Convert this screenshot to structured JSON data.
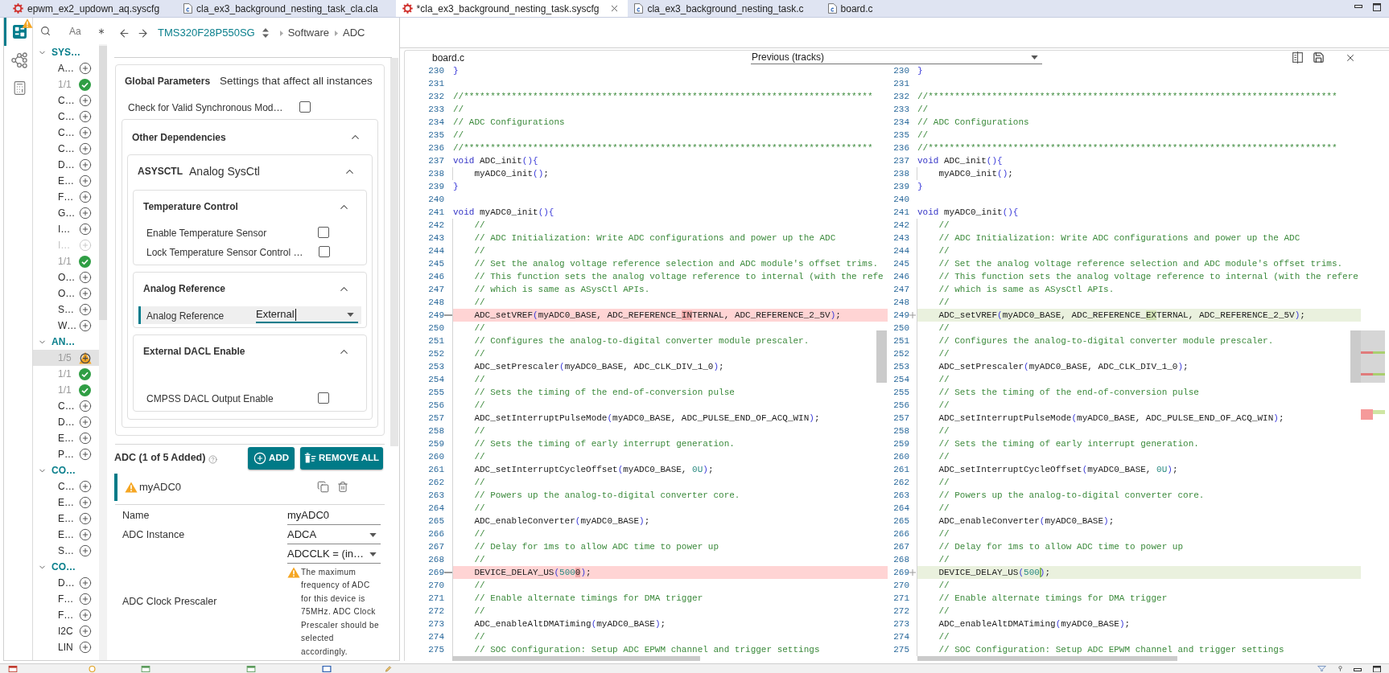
{
  "editor_tabs": [
    {
      "label": "epwm_ex2_updown_aq.syscfg",
      "kind": "syscfg",
      "selected": false
    },
    {
      "label": "cla_ex3_background_nesting_task_cla.cla",
      "kind": "source",
      "selected": false
    },
    {
      "label": "*cla_ex3_background_nesting_task.syscfg",
      "kind": "syscfg",
      "selected": true
    },
    {
      "label": "cla_ex3_background_nesting_task.c",
      "kind": "source",
      "selected": false
    },
    {
      "label": "board.c",
      "kind": "source",
      "selected": false
    }
  ],
  "sysconfig": {
    "sidebar": [
      {
        "kind": "dashboard",
        "selected": true,
        "warning": true
      },
      {
        "kind": "hierarchy",
        "selected": false,
        "warning": false
      },
      {
        "kind": "calculator",
        "selected": false,
        "warning": false
      }
    ],
    "module_tree": {
      "match_case": "Aa",
      "groups": [
        {
          "label": "SYS…",
          "expanded": true,
          "items": [
            {
              "label": "A…",
              "kind": "add",
              "selected": false
            },
            {
              "label": "1/1",
              "kind": "added",
              "selected": false
            },
            {
              "label": "C…",
              "kind": "add",
              "selected": false
            },
            {
              "label": "C…",
              "kind": "add",
              "selected": false
            },
            {
              "label": "C…",
              "kind": "add",
              "selected": false
            },
            {
              "label": "C…",
              "kind": "add",
              "selected": false
            },
            {
              "label": "D…",
              "kind": "add",
              "selected": false
            },
            {
              "label": "E…",
              "kind": "add",
              "selected": false
            },
            {
              "label": "F…",
              "kind": "add",
              "selected": false
            },
            {
              "label": "G…",
              "kind": "add",
              "selected": false
            },
            {
              "label": "I…",
              "kind": "add",
              "selected": false
            },
            {
              "label": "I…",
              "kind": "unavailable",
              "selected": false
            },
            {
              "label": "1/1",
              "kind": "added",
              "selected": false
            },
            {
              "label": "O…",
              "kind": "add",
              "selected": false
            },
            {
              "label": "O…",
              "kind": "add",
              "selected": false
            },
            {
              "label": "S…",
              "kind": "add",
              "selected": false
            },
            {
              "label": "W…",
              "kind": "add",
              "selected": false
            }
          ]
        },
        {
          "label": "AN…",
          "expanded": true,
          "items": [
            {
              "label": "1/5",
              "kind": "warning",
              "selected": true
            },
            {
              "label": "1/1",
              "kind": "added",
              "selected": false
            },
            {
              "label": "1/1",
              "kind": "added",
              "selected": false
            },
            {
              "label": "C…",
              "kind": "add",
              "selected": false
            },
            {
              "label": "D…",
              "kind": "add",
              "selected": false
            },
            {
              "label": "E…",
              "kind": "add",
              "selected": false
            },
            {
              "label": "P…",
              "kind": "add",
              "selected": false
            }
          ]
        },
        {
          "label": "CO…",
          "expanded": true,
          "items": [
            {
              "label": "C…",
              "kind": "add",
              "selected": false
            },
            {
              "label": "E…",
              "kind": "add",
              "selected": false
            },
            {
              "label": "E…",
              "kind": "add",
              "selected": false
            },
            {
              "label": "E…",
              "kind": "add",
              "selected": false
            },
            {
              "label": "S…",
              "kind": "add",
              "selected": false
            }
          ]
        },
        {
          "label": "CO…",
          "expanded": true,
          "items": [
            {
              "label": "D…",
              "kind": "add",
              "selected": false
            },
            {
              "label": "F…",
              "kind": "add",
              "selected": false
            },
            {
              "label": "F…",
              "kind": "add",
              "selected": false
            },
            {
              "label": "I2C",
              "kind": "add",
              "selected": false
            },
            {
              "label": "LIN",
              "kind": "add",
              "selected": false
            }
          ]
        }
      ]
    },
    "breadcrumb": {
      "device": "TMS320F28P550SG",
      "path": [
        "Software",
        "ADC"
      ]
    },
    "global_parameters": {
      "title": "Global Parameters",
      "subtitle": "Settings that affect all instances",
      "settings": [
        {
          "label": "Check for Valid Synchronous Mod…",
          "checked": false
        }
      ],
      "dependencies": {
        "title": "Other Dependencies",
        "expanded": true,
        "modules": [
          {
            "code": "ASYSCTL",
            "name": "Analog SysCtl",
            "expanded": true,
            "groups": [
              {
                "title": "Temperature Control",
                "expanded": true,
                "fields": [
                  {
                    "kind": "checkbox",
                    "label": "Enable Temperature Sensor",
                    "checked": false
                  },
                  {
                    "kind": "checkbox",
                    "label": "Lock Temperature Sensor Control …",
                    "checked": false
                  }
                ]
              },
              {
                "title": "Analog Reference",
                "expanded": true,
                "fields": [
                  {
                    "kind": "dropdown",
                    "label": "Analog Reference",
                    "value": "External",
                    "focused": true
                  }
                ]
              },
              {
                "title": "External DACL Enable",
                "expanded": true,
                "fields": [
                  {
                    "kind": "checkbox",
                    "label": "CMPSS DACL Output Enable",
                    "checked": false
                  }
                ]
              }
            ]
          }
        ]
      }
    },
    "module": {
      "title": "ADC (1 of 5 Added)",
      "buttons": [
        {
          "kind": "add",
          "label": "ADD"
        },
        {
          "kind": "remove_all",
          "label": "REMOVE ALL"
        }
      ],
      "instances": [
        {
          "name": "myADC0",
          "warning": true,
          "selected": true
        }
      ],
      "fields": [
        {
          "kind": "text",
          "label": "Name",
          "value": "myADC0"
        },
        {
          "kind": "dropdown",
          "label": "ADC Instance",
          "value": "ADCA"
        },
        {
          "kind": "dropdown",
          "label": "ADC Clock Prescaler",
          "value": "ADCCLK = (in…",
          "warning": "The maximum frequency of ADC for this device is 75MHz. ADC Clock Prescaler should be selected accordingly."
        }
      ]
    }
  },
  "compare": {
    "title": "board.c",
    "source": "Previous (tracks)",
    "panes": [
      {
        "kind": "local",
        "lines": [
          {
            "number": "230",
            "changed": false,
            "segments": [
              {
                "kind": "bracket",
                "text": "}"
              }
            ]
          },
          {
            "number": "231",
            "changed": false
          },
          {
            "number": "232",
            "changed": false,
            "segments": [
              {
                "kind": "comment",
                "text": "//*****************************************************************************"
              }
            ]
          },
          {
            "number": "233",
            "changed": false,
            "segments": [
              {
                "kind": "comment",
                "text": "//"
              }
            ]
          },
          {
            "number": "234",
            "changed": false,
            "segments": [
              {
                "kind": "comment",
                "text": "// ADC Configurations"
              }
            ]
          },
          {
            "number": "235",
            "changed": false,
            "segments": [
              {
                "kind": "comment",
                "text": "//"
              }
            ]
          },
          {
            "number": "236",
            "changed": false,
            "segments": [
              {
                "kind": "comment",
                "text": "//*****************************************************************************"
              }
            ]
          },
          {
            "number": "237",
            "changed": false,
            "segments": [
              {
                "kind": "keyword",
                "text": "void"
              },
              {
                "kind": "plain",
                "text": " ADC_init"
              },
              {
                "kind": "bracket",
                "text": "(){"
              }
            ]
          },
          {
            "number": "238",
            "changed": false,
            "segments": [
              {
                "kind": "plain",
                "text": "    myADC0_init"
              },
              {
                "kind": "bracket",
                "text": "()"
              },
              {
                "kind": "plain",
                "text": ";"
              }
            ]
          },
          {
            "number": "239",
            "changed": false,
            "segments": [
              {
                "kind": "bracket",
                "text": "}"
              }
            ]
          },
          {
            "number": "240",
            "changed": false
          },
          {
            "number": "241",
            "changed": false,
            "segments": [
              {
                "kind": "keyword",
                "text": "void"
              },
              {
                "kind": "plain",
                "text": " myADC0_init"
              },
              {
                "kind": "bracket",
                "text": "(){"
              }
            ]
          },
          {
            "number": "242",
            "changed": false,
            "segments": [
              {
                "kind": "comment",
                "text": "    //"
              }
            ]
          },
          {
            "number": "243",
            "changed": false,
            "segments": [
              {
                "kind": "comment",
                "text": "    // ADC Initialization: Write ADC configurations and power up the ADC"
              }
            ]
          },
          {
            "number": "244",
            "changed": false,
            "segments": [
              {
                "kind": "comment",
                "text": "    //"
              }
            ]
          },
          {
            "number": "245",
            "changed": false,
            "segments": [
              {
                "kind": "comment",
                "text": "    // Set the analog voltage reference selection and ADC module's offset trims."
              }
            ]
          },
          {
            "number": "246",
            "changed": false,
            "segments": [
              {
                "kind": "comment",
                "text": "    // This function sets the analog voltage reference to internal (with the refe"
              }
            ]
          },
          {
            "number": "247",
            "changed": false,
            "segments": [
              {
                "kind": "comment",
                "text": "    // which is same as ASysCtl APIs."
              }
            ]
          },
          {
            "number": "248",
            "changed": false,
            "segments": [
              {
                "kind": "comment",
                "text": "    //"
              }
            ]
          },
          {
            "number": "249",
            "changed": true,
            "segments": [
              {
                "kind": "plain",
                "text": "    ADC_setVREF"
              },
              {
                "kind": "bracket",
                "text": "("
              },
              {
                "kind": "plain",
                "text": "myADC0_BASE, ADC_REFERENCE_"
              },
              {
                "kind": "diff",
                "text": "IN"
              },
              {
                "kind": "plain",
                "text": "TERNAL, ADC_REFERENCE_2_5V"
              },
              {
                "kind": "bracket",
                "text": ")"
              },
              {
                "kind": "plain",
                "text": ";"
              }
            ]
          },
          {
            "number": "250",
            "changed": false,
            "segments": [
              {
                "kind": "comment",
                "text": "    //"
              }
            ]
          },
          {
            "number": "251",
            "changed": false,
            "segments": [
              {
                "kind": "comment",
                "text": "    // Configures the analog-to-digital converter module prescaler."
              }
            ]
          },
          {
            "number": "252",
            "changed": false,
            "segments": [
              {
                "kind": "comment",
                "text": "    //"
              }
            ]
          },
          {
            "number": "253",
            "changed": false,
            "segments": [
              {
                "kind": "plain",
                "text": "    ADC_setPrescaler"
              },
              {
                "kind": "bracket",
                "text": "("
              },
              {
                "kind": "plain",
                "text": "myADC0_BASE, ADC_CLK_DIV_1_0"
              },
              {
                "kind": "bracket",
                "text": ")"
              },
              {
                "kind": "plain",
                "text": ";"
              }
            ]
          },
          {
            "number": "254",
            "changed": false,
            "segments": [
              {
                "kind": "comment",
                "text": "    //"
              }
            ]
          },
          {
            "number": "255",
            "changed": false,
            "segments": [
              {
                "kind": "comment",
                "text": "    // Sets the timing of the end-of-conversion pulse"
              }
            ]
          },
          {
            "number": "256",
            "changed": false,
            "segments": [
              {
                "kind": "comment",
                "text": "    //"
              }
            ]
          },
          {
            "number": "257",
            "changed": false,
            "segments": [
              {
                "kind": "plain",
                "text": "    ADC_setInterruptPulseMode"
              },
              {
                "kind": "bracket",
                "text": "("
              },
              {
                "kind": "plain",
                "text": "myADC0_BASE, ADC_PULSE_END_OF_ACQ_WIN"
              },
              {
                "kind": "bracket",
                "text": ")"
              },
              {
                "kind": "plain",
                "text": ";"
              }
            ]
          },
          {
            "number": "258",
            "changed": false,
            "segments": [
              {
                "kind": "comment",
                "text": "    //"
              }
            ]
          },
          {
            "number": "259",
            "changed": false,
            "segments": [
              {
                "kind": "comment",
                "text": "    // Sets the timing of early interrupt generation."
              }
            ]
          },
          {
            "number": "260",
            "changed": false,
            "segments": [
              {
                "kind": "comment",
                "text": "    //"
              }
            ]
          },
          {
            "number": "261",
            "changed": false,
            "segments": [
              {
                "kind": "plain",
                "text": "    ADC_setInterruptCycleOffset"
              },
              {
                "kind": "bracket",
                "text": "("
              },
              {
                "kind": "plain",
                "text": "myADC0_BASE, "
              },
              {
                "kind": "number",
                "text": "0U"
              },
              {
                "kind": "bracket",
                "text": ")"
              },
              {
                "kind": "plain",
                "text": ";"
              }
            ]
          },
          {
            "number": "262",
            "changed": false,
            "segments": [
              {
                "kind": "comment",
                "text": "    //"
              }
            ]
          },
          {
            "number": "263",
            "changed": false,
            "segments": [
              {
                "kind": "comment",
                "text": "    // Powers up the analog-to-digital converter core."
              }
            ]
          },
          {
            "number": "264",
            "changed": false,
            "segments": [
              {
                "kind": "comment",
                "text": "    //"
              }
            ]
          },
          {
            "number": "265",
            "changed": false,
            "segments": [
              {
                "kind": "plain",
                "text": "    ADC_enableConverter"
              },
              {
                "kind": "bracket",
                "text": "("
              },
              {
                "kind": "plain",
                "text": "myADC0_BASE"
              },
              {
                "kind": "bracket",
                "text": ")"
              },
              {
                "kind": "plain",
                "text": ";"
              }
            ]
          },
          {
            "number": "266",
            "changed": false,
            "segments": [
              {
                "kind": "comment",
                "text": "    //"
              }
            ]
          },
          {
            "number": "267",
            "changed": false,
            "segments": [
              {
                "kind": "comment",
                "text": "    // Delay for 1ms to allow ADC time to power up"
              }
            ]
          },
          {
            "number": "268",
            "changed": false,
            "segments": [
              {
                "kind": "comment",
                "text": "    //"
              }
            ]
          },
          {
            "number": "269",
            "changed": true,
            "segments": [
              {
                "kind": "plain",
                "text": "    DEVICE_DELAY_US"
              },
              {
                "kind": "bracket",
                "text": "("
              },
              {
                "kind": "number",
                "text": "500"
              },
              {
                "kind": "diff",
                "text": "0"
              },
              {
                "kind": "bracket",
                "text": ")"
              },
              {
                "kind": "plain",
                "text": ";"
              }
            ]
          },
          {
            "number": "270",
            "changed": false,
            "segments": [
              {
                "kind": "comment",
                "text": "    //"
              }
            ]
          },
          {
            "number": "271",
            "changed": false,
            "segments": [
              {
                "kind": "comment",
                "text": "    // Enable alternate timings for DMA trigger"
              }
            ]
          },
          {
            "number": "272",
            "changed": false,
            "segments": [
              {
                "kind": "comment",
                "text": "    //"
              }
            ]
          },
          {
            "number": "273",
            "changed": false,
            "segments": [
              {
                "kind": "plain",
                "text": "    ADC_enableAltDMATiming"
              },
              {
                "kind": "bracket",
                "text": "("
              },
              {
                "kind": "plain",
                "text": "myADC0_BASE"
              },
              {
                "kind": "bracket",
                "text": ")"
              },
              {
                "kind": "plain",
                "text": ";"
              }
            ]
          },
          {
            "number": "274",
            "changed": false,
            "segments": [
              {
                "kind": "comment",
                "text": "    //"
              }
            ]
          },
          {
            "number": "275",
            "changed": false,
            "segments": [
              {
                "kind": "comment",
                "text": "    // SOC Configuration: Setup ADC EPWM channel and trigger settings"
              }
            ]
          }
        ]
      },
      {
        "kind": "previous",
        "lines": [
          {
            "number": "230",
            "changed": false,
            "segments": [
              {
                "kind": "bracket",
                "text": "}"
              }
            ]
          },
          {
            "number": "231",
            "changed": false
          },
          {
            "number": "232",
            "changed": false,
            "segments": [
              {
                "kind": "comment",
                "text": "//*****************************************************************************"
              }
            ]
          },
          {
            "number": "233",
            "changed": false,
            "segments": [
              {
                "kind": "comment",
                "text": "//"
              }
            ]
          },
          {
            "number": "234",
            "changed": false,
            "segments": [
              {
                "kind": "comment",
                "text": "// ADC Configurations"
              }
            ]
          },
          {
            "number": "235",
            "changed": false,
            "segments": [
              {
                "kind": "comment",
                "text": "//"
              }
            ]
          },
          {
            "number": "236",
            "changed": false,
            "segments": [
              {
                "kind": "comment",
                "text": "//*****************************************************************************"
              }
            ]
          },
          {
            "number": "237",
            "changed": false,
            "segments": [
              {
                "kind": "keyword",
                "text": "void"
              },
              {
                "kind": "plain",
                "text": " ADC_init"
              },
              {
                "kind": "bracket",
                "text": "(){"
              }
            ]
          },
          {
            "number": "238",
            "changed": false,
            "segments": [
              {
                "kind": "plain",
                "text": "    myADC0_init"
              },
              {
                "kind": "bracket",
                "text": "()"
              },
              {
                "kind": "plain",
                "text": ";"
              }
            ]
          },
          {
            "number": "239",
            "changed": false,
            "segments": [
              {
                "kind": "bracket",
                "text": "}"
              }
            ]
          },
          {
            "number": "240",
            "changed": false
          },
          {
            "number": "241",
            "changed": false,
            "segments": [
              {
                "kind": "keyword",
                "text": "void"
              },
              {
                "kind": "plain",
                "text": " myADC0_init"
              },
              {
                "kind": "bracket",
                "text": "(){"
              }
            ]
          },
          {
            "number": "242",
            "changed": false,
            "segments": [
              {
                "kind": "comment",
                "text": "    //"
              }
            ]
          },
          {
            "number": "243",
            "changed": false,
            "segments": [
              {
                "kind": "comment",
                "text": "    // ADC Initialization: Write ADC configurations and power up the ADC"
              }
            ]
          },
          {
            "number": "244",
            "changed": false,
            "segments": [
              {
                "kind": "comment",
                "text": "    //"
              }
            ]
          },
          {
            "number": "245",
            "changed": false,
            "segments": [
              {
                "kind": "comment",
                "text": "    // Set the analog voltage reference selection and ADC module's offset trims."
              }
            ]
          },
          {
            "number": "246",
            "changed": false,
            "segments": [
              {
                "kind": "comment",
                "text": "    // This function sets the analog voltage reference to internal (with the refere"
              }
            ]
          },
          {
            "number": "247",
            "changed": false,
            "segments": [
              {
                "kind": "comment",
                "text": "    // which is same as ASysCtl APIs."
              }
            ]
          },
          {
            "number": "248",
            "changed": false,
            "segments": [
              {
                "kind": "comment",
                "text": "    //"
              }
            ]
          },
          {
            "number": "249",
            "changed": true,
            "segments": [
              {
                "kind": "plain",
                "text": "    ADC_setVREF"
              },
              {
                "kind": "bracket",
                "text": "("
              },
              {
                "kind": "plain",
                "text": "myADC0_BASE, ADC_REFERENCE_"
              },
              {
                "kind": "diff",
                "text": "EX"
              },
              {
                "kind": "plain",
                "text": "TERNAL, ADC_REFERENCE_2_5V"
              },
              {
                "kind": "bracket",
                "text": ")"
              },
              {
                "kind": "plain",
                "text": ";"
              }
            ]
          },
          {
            "number": "250",
            "changed": false,
            "segments": [
              {
                "kind": "comment",
                "text": "    //"
              }
            ]
          },
          {
            "number": "251",
            "changed": false,
            "segments": [
              {
                "kind": "comment",
                "text": "    // Configures the analog-to-digital converter module prescaler."
              }
            ]
          },
          {
            "number": "252",
            "changed": false,
            "segments": [
              {
                "kind": "comment",
                "text": "    //"
              }
            ]
          },
          {
            "number": "253",
            "changed": false,
            "segments": [
              {
                "kind": "plain",
                "text": "    ADC_setPrescaler"
              },
              {
                "kind": "bracket",
                "text": "("
              },
              {
                "kind": "plain",
                "text": "myADC0_BASE, ADC_CLK_DIV_1_0"
              },
              {
                "kind": "bracket",
                "text": ")"
              },
              {
                "kind": "plain",
                "text": ";"
              }
            ]
          },
          {
            "number": "254",
            "changed": false,
            "segments": [
              {
                "kind": "comment",
                "text": "    //"
              }
            ]
          },
          {
            "number": "255",
            "changed": false,
            "segments": [
              {
                "kind": "comment",
                "text": "    // Sets the timing of the end-of-conversion pulse"
              }
            ]
          },
          {
            "number": "256",
            "changed": false,
            "segments": [
              {
                "kind": "comment",
                "text": "    //"
              }
            ]
          },
          {
            "number": "257",
            "changed": false,
            "segments": [
              {
                "kind": "plain",
                "text": "    ADC_setInterruptPulseMode"
              },
              {
                "kind": "bracket",
                "text": "("
              },
              {
                "kind": "plain",
                "text": "myADC0_BASE, ADC_PULSE_END_OF_ACQ_WIN"
              },
              {
                "kind": "bracket",
                "text": ")"
              },
              {
                "kind": "plain",
                "text": ";"
              }
            ]
          },
          {
            "number": "258",
            "changed": false,
            "segments": [
              {
                "kind": "comment",
                "text": "    //"
              }
            ]
          },
          {
            "number": "259",
            "changed": false,
            "segments": [
              {
                "kind": "comment",
                "text": "    // Sets the timing of early interrupt generation."
              }
            ]
          },
          {
            "number": "260",
            "changed": false,
            "segments": [
              {
                "kind": "comment",
                "text": "    //"
              }
            ]
          },
          {
            "number": "261",
            "changed": false,
            "segments": [
              {
                "kind": "plain",
                "text": "    ADC_setInterruptCycleOffset"
              },
              {
                "kind": "bracket",
                "text": "("
              },
              {
                "kind": "plain",
                "text": "myADC0_BASE, "
              },
              {
                "kind": "number",
                "text": "0U"
              },
              {
                "kind": "bracket",
                "text": ")"
              },
              {
                "kind": "plain",
                "text": ";"
              }
            ]
          },
          {
            "number": "262",
            "changed": false,
            "segments": [
              {
                "kind": "comment",
                "text": "    //"
              }
            ]
          },
          {
            "number": "263",
            "changed": false,
            "segments": [
              {
                "kind": "comment",
                "text": "    // Powers up the analog-to-digital converter core."
              }
            ]
          },
          {
            "number": "264",
            "changed": false,
            "segments": [
              {
                "kind": "comment",
                "text": "    //"
              }
            ]
          },
          {
            "number": "265",
            "changed": false,
            "segments": [
              {
                "kind": "plain",
                "text": "    ADC_enableConverter"
              },
              {
                "kind": "bracket",
                "text": "("
              },
              {
                "kind": "plain",
                "text": "myADC0_BASE"
              },
              {
                "kind": "bracket",
                "text": ")"
              },
              {
                "kind": "plain",
                "text": ";"
              }
            ]
          },
          {
            "number": "266",
            "changed": false,
            "segments": [
              {
                "kind": "comment",
                "text": "    //"
              }
            ]
          },
          {
            "number": "267",
            "changed": false,
            "segments": [
              {
                "kind": "comment",
                "text": "    // Delay for 1ms to allow ADC time to power up"
              }
            ]
          },
          {
            "number": "268",
            "changed": false,
            "segments": [
              {
                "kind": "comment",
                "text": "    //"
              }
            ]
          },
          {
            "number": "269",
            "changed": true,
            "segments": [
              {
                "kind": "plain",
                "text": "    DEVICE_DELAY_US"
              },
              {
                "kind": "bracket",
                "text": "("
              },
              {
                "kind": "number",
                "text": "500"
              },
              {
                "kind": "insert"
              },
              {
                "kind": "bracket",
                "text": ")"
              },
              {
                "kind": "plain",
                "text": ";"
              }
            ]
          },
          {
            "number": "270",
            "changed": false,
            "segments": [
              {
                "kind": "comment",
                "text": "    //"
              }
            ]
          },
          {
            "number": "271",
            "changed": false,
            "segments": [
              {
                "kind": "comment",
                "text": "    // Enable alternate timings for DMA trigger"
              }
            ]
          },
          {
            "number": "272",
            "changed": false,
            "segments": [
              {
                "kind": "comment",
                "text": "    //"
              }
            ]
          },
          {
            "number": "273",
            "changed": false,
            "segments": [
              {
                "kind": "plain",
                "text": "    ADC_enableAltDMATiming"
              },
              {
                "kind": "bracket",
                "text": "("
              },
              {
                "kind": "plain",
                "text": "myADC0_BASE"
              },
              {
                "kind": "bracket",
                "text": ")"
              },
              {
                "kind": "plain",
                "text": ";"
              }
            ]
          },
          {
            "number": "274",
            "changed": false,
            "segments": [
              {
                "kind": "comment",
                "text": "    //"
              }
            ]
          },
          {
            "number": "275",
            "changed": false,
            "segments": [
              {
                "kind": "comment",
                "text": "    // SOC Configuration: Setup ADC EPWM channel and trigger settings"
              }
            ]
          }
        ]
      }
    ]
  }
}
